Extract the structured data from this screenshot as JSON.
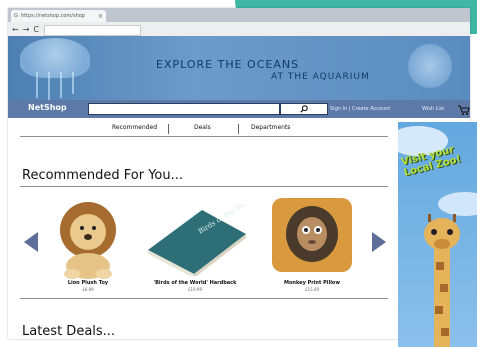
{
  "browser": {
    "tab_title": "https://netshop.com/shop",
    "nav_back": "←",
    "nav_forward": "→",
    "nav_reload": "C"
  },
  "banner": {
    "line1": "EXPLORE THE OCEANS",
    "line2": "AT THE AQUARIUM"
  },
  "header": {
    "logo": "NetShop",
    "search_placeholder": "",
    "search_icon": "magnifier-icon",
    "account_links": "Sign In | Create Account",
    "wish_list": "Wish List",
    "cart_icon": "cart-icon"
  },
  "menu": {
    "items": [
      "Recommended",
      "Deals",
      "Departments"
    ]
  },
  "recommended": {
    "title": "Recommended For You...",
    "products": [
      {
        "name": "Lion Plush Toy",
        "price": "£6.99"
      },
      {
        "name": "'Birds of the World' Hardback",
        "price": "£19.99"
      },
      {
        "name": "Monkey Print Pillow",
        "price": "£15.00"
      }
    ]
  },
  "book_cover_text": "Birds of the World",
  "deals": {
    "title": "Latest Deals..."
  },
  "ad": {
    "line1": "Visit your",
    "line2": "Local Zoo!"
  },
  "colors": {
    "header_bar": "#5d79a7",
    "banner": "#5a8cc0",
    "arrows": "#5f6d99",
    "teal_corner": "#3fb8a6"
  }
}
